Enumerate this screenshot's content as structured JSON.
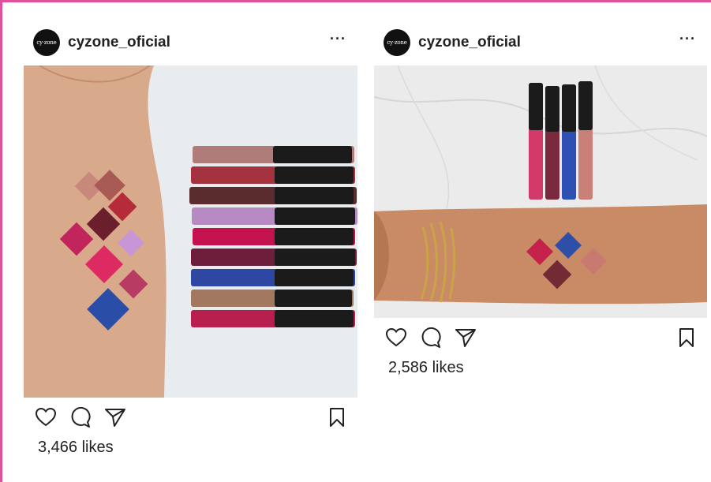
{
  "posts": [
    {
      "username": "cyzone_oficial",
      "avatar_text": "cy·zone",
      "more_label": "···",
      "likes": "3,466 likes",
      "icons": [
        "heart-icon",
        "comment-icon",
        "share-icon",
        "bookmark-icon"
      ]
    },
    {
      "username": "cyzone_oficial",
      "avatar_text": "cy·zone",
      "more_label": "···",
      "likes": "2,586 likes",
      "icons": [
        "heart-icon",
        "comment-icon",
        "share-icon",
        "bookmark-icon"
      ]
    }
  ],
  "colors": {
    "frame_border": "#e0519c",
    "text": "#222222",
    "skin": "#d6a58a",
    "marble": "#ebebeb"
  }
}
